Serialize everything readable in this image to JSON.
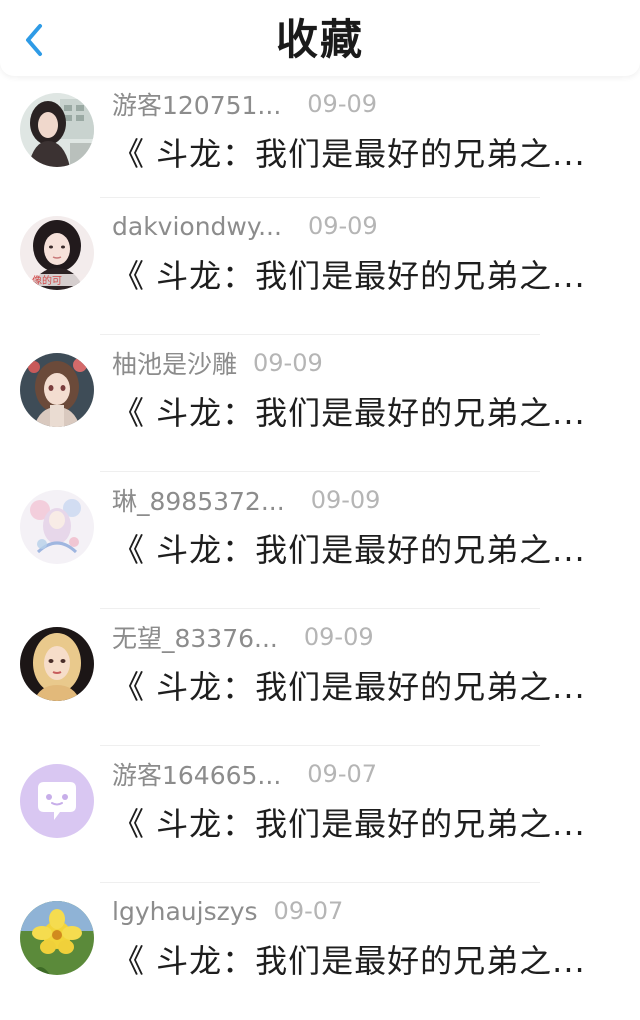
{
  "header": {
    "title": "收藏",
    "back_icon": "chevron-left-icon",
    "accent_color": "#2e9be6"
  },
  "items": [
    {
      "username": "游客120751...",
      "date": "09-09",
      "content": "《 斗龙：我们是最好的兄弟之...",
      "avatar": "girl-photo-avatar"
    },
    {
      "username": "dakviondwy...",
      "date": "09-09",
      "content": "《 斗龙：我们是最好的兄弟之...",
      "avatar": "girl-portrait-avatar"
    },
    {
      "username": "柚池是沙雕",
      "date": "09-09",
      "content": "《 斗龙：我们是最好的兄弟之...",
      "avatar": "anime-girl-avatar"
    },
    {
      "username": "琳_8985372...",
      "date": "09-09",
      "content": "《 斗龙：我们是最好的兄弟之...",
      "avatar": "pastel-art-avatar"
    },
    {
      "username": "无望_83376...",
      "date": "09-09",
      "content": "《 斗龙：我们是最好的兄弟之...",
      "avatar": "blonde-girl-avatar"
    },
    {
      "username": "游客164665...",
      "date": "09-07",
      "content": "《 斗龙：我们是最好的兄弟之...",
      "avatar": "chat-bubble-avatar"
    },
    {
      "username": "lgyhaujszys",
      "date": "09-07",
      "content": "《 斗龙：我们是最好的兄弟之...",
      "avatar": "yellow-flower-avatar"
    }
  ]
}
